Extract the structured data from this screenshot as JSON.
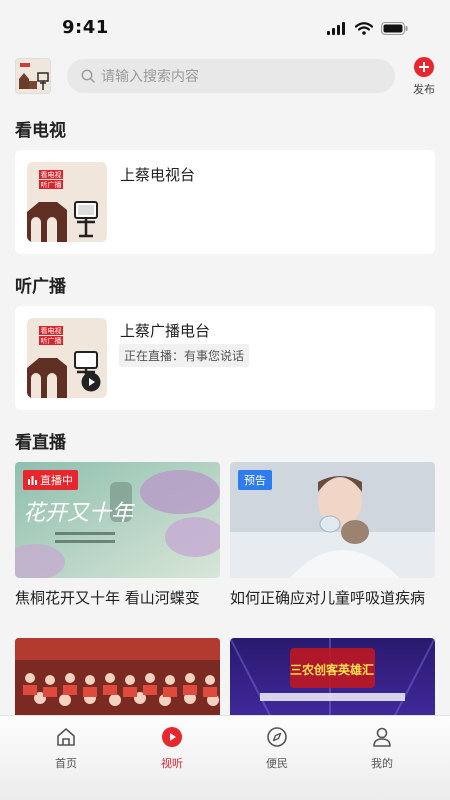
{
  "status": {
    "time": "9:41"
  },
  "search": {
    "placeholder": "请输入搜索内容"
  },
  "publish": {
    "label": "发布"
  },
  "sections": {
    "tv": "看电视",
    "radio": "听广播",
    "live": "看直播"
  },
  "tv_card": {
    "title": "上蔡电视台"
  },
  "radio_card": {
    "title": "上蔡广播电台",
    "status_text": "正在直播：有事您说话"
  },
  "thumb_art": {
    "line1": "看电视",
    "line2": "听广播"
  },
  "live_items": [
    {
      "title": "焦桐花开又十年 看山河蝶变",
      "badge": "直播中",
      "art_text": "花开又十年"
    },
    {
      "title": "如何正确应对儿童呼吸道疾病",
      "badge": "预告"
    },
    {
      "title": ""
    },
    {
      "title": "",
      "art_text": "三农创客英雄汇"
    }
  ],
  "tabs": [
    {
      "label": "首页",
      "icon": "home-icon"
    },
    {
      "label": "视听",
      "icon": "play-icon",
      "active": true
    },
    {
      "label": "便民",
      "icon": "compass-icon"
    },
    {
      "label": "我的",
      "icon": "user-icon"
    }
  ],
  "colors": {
    "accent": "#e8262d",
    "preview_badge": "#2d7cf0",
    "background": "#f4f4f4"
  }
}
